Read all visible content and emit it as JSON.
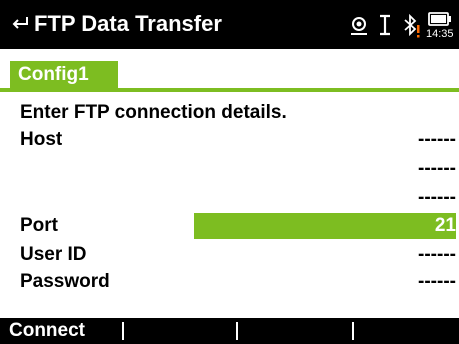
{
  "titlebar": {
    "title": "FTP Data Transfer",
    "time": "14:35",
    "icons": [
      "back-arrow-icon",
      "target-status-icon",
      "cursor-i-icon",
      "bluetooth-warning-icon",
      "battery-icon"
    ],
    "colors": {
      "warning": "#ff6a00",
      "accent": "#7dbd21"
    }
  },
  "tabs": [
    {
      "label": "Config1",
      "active": true
    }
  ],
  "form": {
    "instruction": "Enter FTP connection details.",
    "host_label": "Host",
    "host_line1": "------",
    "host_line2": "------",
    "host_line3": "------",
    "port_label": "Port",
    "port_value": "21",
    "userid_label": "User ID",
    "userid_value": "------",
    "password_label": "Password",
    "password_value": "------"
  },
  "softkeys": [
    "Connect",
    "",
    "",
    ""
  ]
}
